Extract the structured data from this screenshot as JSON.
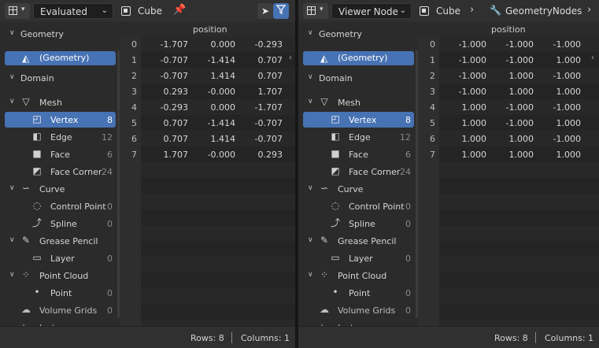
{
  "left": {
    "header": {
      "mode": "Evaluated",
      "object": "Cube"
    },
    "tree": {
      "geometry_label": "Geometry",
      "geometry_item": "(Geometry)",
      "domain_label": "Domain",
      "items": [
        {
          "kind": "group",
          "label": "Mesh",
          "icon": "mesh-icon"
        },
        {
          "kind": "leaf",
          "label": "Vertex",
          "count": "8",
          "icon": "vertex-icon",
          "selected": true
        },
        {
          "kind": "leaf",
          "label": "Edge",
          "count": "12",
          "icon": "edge-icon"
        },
        {
          "kind": "leaf",
          "label": "Face",
          "count": "6",
          "icon": "face-icon"
        },
        {
          "kind": "leaf",
          "label": "Face Corner",
          "count": "24",
          "icon": "face-corner-icon"
        },
        {
          "kind": "group",
          "label": "Curve",
          "icon": "curve-icon"
        },
        {
          "kind": "leaf",
          "label": "Control Point",
          "count": "0",
          "icon": "control-point-icon"
        },
        {
          "kind": "leaf",
          "label": "Spline",
          "count": "0",
          "icon": "spline-icon"
        },
        {
          "kind": "group",
          "label": "Grease Pencil",
          "icon": "grease-pencil-icon"
        },
        {
          "kind": "leaf",
          "label": "Layer",
          "count": "0",
          "icon": "layer-icon"
        },
        {
          "kind": "group",
          "label": "Point Cloud",
          "icon": "point-cloud-icon"
        },
        {
          "kind": "leaf",
          "label": "Point",
          "count": "0",
          "icon": "point-icon"
        },
        {
          "kind": "plain",
          "label": "Volume Grids",
          "count": "0",
          "icon": "volume-icon"
        },
        {
          "kind": "plain",
          "label": "Instances",
          "count": "",
          "icon": "instances-icon"
        }
      ]
    },
    "table": {
      "column": "position",
      "rows": [
        [
          "0",
          "-1.707",
          "0.000",
          "-0.293"
        ],
        [
          "1",
          "-0.707",
          "-1.414",
          "0.707"
        ],
        [
          "2",
          "-0.707",
          "1.414",
          "0.707"
        ],
        [
          "3",
          "0.293",
          "-0.000",
          "1.707"
        ],
        [
          "4",
          "-0.293",
          "0.000",
          "-1.707"
        ],
        [
          "5",
          "0.707",
          "-1.414",
          "-0.707"
        ],
        [
          "6",
          "0.707",
          "1.414",
          "-0.707"
        ],
        [
          "7",
          "1.707",
          "-0.000",
          "0.293"
        ]
      ]
    },
    "footer": {
      "rows": "Rows: 8",
      "columns": "Columns: 1"
    }
  },
  "right": {
    "header": {
      "mode": "Viewer Node",
      "object": "Cube",
      "modifier": "GeometryNodes"
    },
    "tree": {
      "geometry_label": "Geometry",
      "geometry_item": "(Geometry)",
      "domain_label": "Domain",
      "items": [
        {
          "kind": "group",
          "label": "Mesh",
          "icon": "mesh-icon"
        },
        {
          "kind": "leaf",
          "label": "Vertex",
          "count": "8",
          "icon": "vertex-icon",
          "selected": true
        },
        {
          "kind": "leaf",
          "label": "Edge",
          "count": "12",
          "icon": "edge-icon"
        },
        {
          "kind": "leaf",
          "label": "Face",
          "count": "6",
          "icon": "face-icon"
        },
        {
          "kind": "leaf",
          "label": "Face Corner",
          "count": "24",
          "icon": "face-corner-icon"
        },
        {
          "kind": "group",
          "label": "Curve",
          "icon": "curve-icon"
        },
        {
          "kind": "leaf",
          "label": "Control Point",
          "count": "0",
          "icon": "control-point-icon"
        },
        {
          "kind": "leaf",
          "label": "Spline",
          "count": "0",
          "icon": "spline-icon"
        },
        {
          "kind": "group",
          "label": "Grease Pencil",
          "icon": "grease-pencil-icon"
        },
        {
          "kind": "leaf",
          "label": "Layer",
          "count": "0",
          "icon": "layer-icon"
        },
        {
          "kind": "group",
          "label": "Point Cloud",
          "icon": "point-cloud-icon"
        },
        {
          "kind": "leaf",
          "label": "Point",
          "count": "0",
          "icon": "point-icon"
        },
        {
          "kind": "plain",
          "label": "Volume Grids",
          "count": "0",
          "icon": "volume-icon"
        },
        {
          "kind": "plain",
          "label": "Instances",
          "count": "",
          "icon": "instances-icon"
        }
      ]
    },
    "table": {
      "column": "position",
      "rows": [
        [
          "0",
          "-1.000",
          "-1.000",
          "-1.000"
        ],
        [
          "1",
          "-1.000",
          "-1.000",
          "1.000"
        ],
        [
          "2",
          "-1.000",
          "1.000",
          "-1.000"
        ],
        [
          "3",
          "-1.000",
          "1.000",
          "1.000"
        ],
        [
          "4",
          "1.000",
          "-1.000",
          "-1.000"
        ],
        [
          "5",
          "1.000",
          "-1.000",
          "1.000"
        ],
        [
          "6",
          "1.000",
          "1.000",
          "-1.000"
        ],
        [
          "7",
          "1.000",
          "1.000",
          "1.000"
        ]
      ]
    },
    "footer": {
      "rows": "Rows: 8",
      "columns": "Columns: 1"
    }
  },
  "colors": {
    "accent": "#4772b3",
    "panel": "#2b2b2b",
    "grid": "#242424"
  }
}
